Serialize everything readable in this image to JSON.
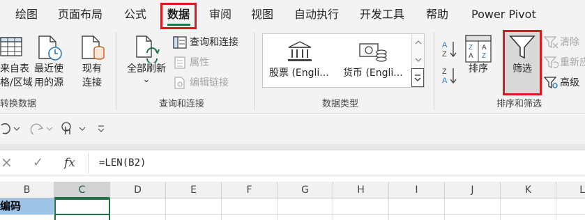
{
  "tabs": [
    "绘图",
    "页面布局",
    "公式",
    "数据",
    "审阅",
    "视图",
    "自动执行",
    "开发工具",
    "帮助",
    "Power Pivot"
  ],
  "active_tab": "数据",
  "ribbon": {
    "get_data": {
      "line1": "来自表",
      "line2": "格/区域"
    },
    "recent_sources": {
      "line1": "最近使",
      "line2": "用的源"
    },
    "existing_conn": {
      "line1": "现有",
      "line2": "连接"
    },
    "group_transform": "转换数据",
    "refresh_all": {
      "label": "全部刷新",
      "arrow": "⌄"
    },
    "queries_connections": "查询和连接",
    "properties": "属性",
    "edit_links": "编辑链接",
    "group_queries": "查询和连接",
    "stocks": "股票 (Engli...",
    "currencies": "货币 (Engli...",
    "group_datatypes": "数据类型",
    "sort_label": "排序",
    "filter_label": "筛选",
    "clear_label": "清除",
    "reapply_label": "重新应用",
    "advanced_label": "高级",
    "group_sortfilter": "排序和筛选"
  },
  "formula_bar": {
    "cancel": "×",
    "enter": "✓",
    "fx": "fx",
    "formula": "=LEN(B2)"
  },
  "grid": {
    "columns": [
      "B",
      "C",
      "D",
      "E",
      "F",
      "G",
      "H",
      "I",
      "J",
      "K",
      "L"
    ],
    "selected_column": "C",
    "row2_b": "编码"
  },
  "colors": {
    "accent": "#217346",
    "highlight_box": "#d71920",
    "header_cell_fill": "#9dc3e6"
  }
}
